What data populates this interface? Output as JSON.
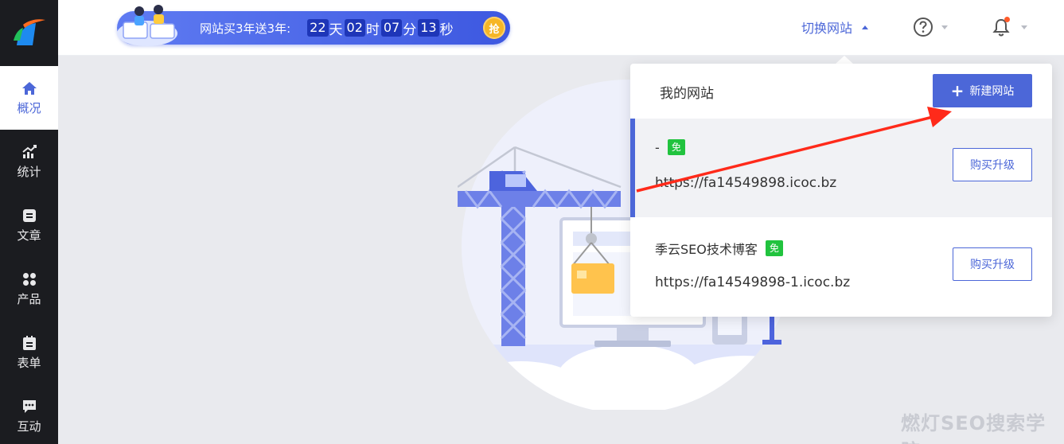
{
  "sidebar": {
    "items": [
      {
        "label": "概况",
        "icon": "home-icon"
      },
      {
        "label": "统计",
        "icon": "chart-trend-icon"
      },
      {
        "label": "文章",
        "icon": "document-icon"
      },
      {
        "label": "产品",
        "icon": "grid-icon"
      },
      {
        "label": "表单",
        "icon": "clipboard-icon"
      },
      {
        "label": "互动",
        "icon": "chat-icon"
      }
    ]
  },
  "promo": {
    "text": "网站买3年送3年:",
    "days": "22",
    "days_unit": "天",
    "hours": "02",
    "hours_unit": "时",
    "minutes": "07",
    "minutes_unit": "分",
    "seconds": "13",
    "seconds_unit": "秒",
    "grab_label": "抢"
  },
  "header": {
    "switch_site": "切换网站"
  },
  "panel": {
    "title": "我的网站",
    "new_site_label": "新建网站",
    "sites": [
      {
        "name": "-",
        "badge": "免",
        "url": "https://fa14549898.icoc.bz",
        "upgrade_label": "购买升级"
      },
      {
        "name": "季云SEO技术博客",
        "badge": "免",
        "url": "https://fa14549898-1.icoc.bz",
        "upgrade_label": "购买升级"
      }
    ]
  },
  "watermark": "燃灯SEO搜索学院",
  "colors": {
    "accent": "#4c67d8",
    "sidebar_bg": "#1b1c20",
    "badge_green": "#21c33e",
    "annotation_red": "#ff2a1a"
  }
}
